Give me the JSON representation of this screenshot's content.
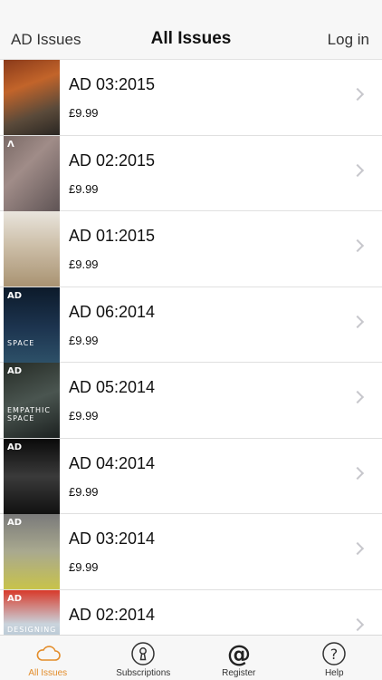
{
  "nav": {
    "left": "AD Issues",
    "title": "All Issues",
    "right": "Log in"
  },
  "issues": [
    {
      "title": "AD 03:2015",
      "price": "£9.99"
    },
    {
      "title": "AD 02:2015",
      "price": "£9.99"
    },
    {
      "title": "AD 01:2015",
      "price": "£9.99"
    },
    {
      "title": "AD 06:2014",
      "price": "£9.99"
    },
    {
      "title": "AD 05:2014",
      "price": "£9.99"
    },
    {
      "title": "AD 04:2014",
      "price": "£9.99"
    },
    {
      "title": "AD 03:2014",
      "price": "£9.99"
    },
    {
      "title": "AD 02:2014",
      "price": ""
    }
  ],
  "covers": [
    {
      "logo": "",
      "text": "",
      "bg": "linear-gradient(160deg,#8a3a1a 0%,#c2642a 35%,#5a4a3a 70%,#2a2622 100%)"
    },
    {
      "logo": "Λ",
      "text": "",
      "bg": "linear-gradient(135deg,#7a6a66 0%,#a08c88 40%,#5f5455 100%)"
    },
    {
      "logo": "",
      "text": "",
      "bg": "linear-gradient(180deg,#e9e5dd 0%,#cdbfa9 45%,#a99372 100%)"
    },
    {
      "logo": "AD",
      "text": "SPACE",
      "bg": "linear-gradient(180deg,#0c1a2a 0%,#1d3550 55%,#2d5068 100%)"
    },
    {
      "logo": "AD",
      "text": "EMPATHIC SPACE",
      "bg": "linear-gradient(160deg,#262c26 0%,#4a5550 50%,#1c2120 100%)"
    },
    {
      "logo": "AD",
      "text": "",
      "bg": "linear-gradient(180deg,#0a0a0a 0%,#3a3a3a 50%,#111 100%)"
    },
    {
      "logo": "AD",
      "text": "",
      "bg": "linear-gradient(180deg,#7a7a7a 0%,#a9a98f 50%,#c8c34a 100%)"
    },
    {
      "logo": "AD",
      "text": "DESIGNING FOR THE THIRD AGE",
      "bg": "linear-gradient(180deg,#d83a2a 0%,#c9d3dc 45%,#9ab6c8 100%)"
    }
  ],
  "tabs": [
    {
      "label": "All Issues",
      "icon": "cloud-icon"
    },
    {
      "label": "Subscriptions",
      "icon": "keyhole-icon"
    },
    {
      "label": "Register",
      "icon": "at-icon"
    },
    {
      "label": "Help",
      "icon": "question-icon"
    }
  ],
  "colors": {
    "accent": "#e38d2b",
    "chevron": "#c7c7cc"
  }
}
